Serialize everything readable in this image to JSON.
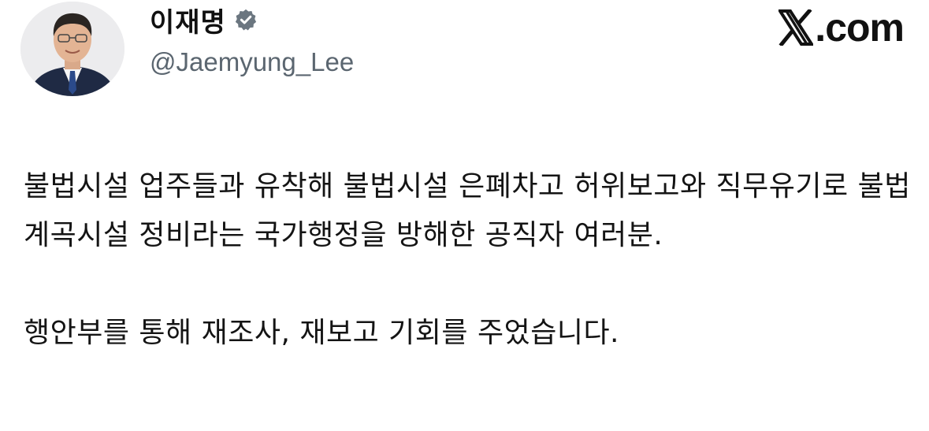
{
  "author": {
    "display_name": "이재명",
    "handle": "@Jaemyung_Lee",
    "verified": true,
    "avatar": "profile-photo"
  },
  "brand": {
    "suffix": ".com",
    "logo": "x-logo"
  },
  "tweet": {
    "paragraph_1": "불법시설 업주들과 유착해 불법시설 은폐차고 허위보고와 직무유기로 불법계곡시설 정비라는 국가행정을 방해한 공직자 여러분.",
    "paragraph_2": "행안부를 통해 재조사, 재보고 기회를 주었습니다."
  },
  "colors": {
    "verified_badge": "#6b7680",
    "handle_text": "#5b6670",
    "body_text": "#141414"
  }
}
